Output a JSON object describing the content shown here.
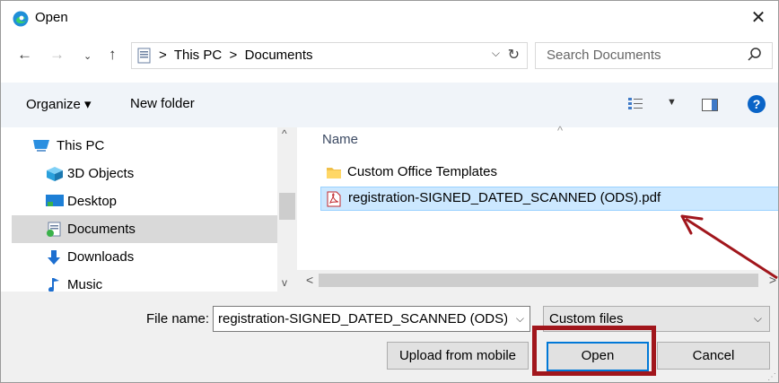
{
  "window": {
    "title": "Open",
    "app_icon": "edge-icon",
    "close_label": "✕"
  },
  "address": {
    "crumbs": [
      "This PC",
      "Documents"
    ],
    "separator": ">",
    "search_placeholder": "Search Documents"
  },
  "toolbar": {
    "organize_label": "Organize ▾",
    "new_folder_label": "New folder",
    "help_label": "?"
  },
  "nav": {
    "items": [
      {
        "label": "This PC",
        "icon": "computer-icon"
      },
      {
        "label": "3D Objects",
        "icon": "3d-objects-icon"
      },
      {
        "label": "Desktop",
        "icon": "desktop-icon"
      },
      {
        "label": "Documents",
        "icon": "documents-icon",
        "selected": true
      },
      {
        "label": "Downloads",
        "icon": "downloads-icon"
      },
      {
        "label": "Music",
        "icon": "music-icon"
      }
    ]
  },
  "files": {
    "column_name": "Name",
    "rows": [
      {
        "label": "Custom Office Templates",
        "icon": "folder-icon"
      },
      {
        "label": "registration-SIGNED_DATED_SCANNED (ODS).pdf",
        "icon": "pdf-icon",
        "selected": true
      }
    ]
  },
  "bottom": {
    "file_name_label": "File name:",
    "file_name_value": "registration-SIGNED_DATED_SCANNED (ODS).",
    "file_type_value": "Custom files",
    "upload_label": "Upload from mobile",
    "open_label": "Open",
    "cancel_label": "Cancel"
  },
  "colors": {
    "annotation": "#a1161c",
    "selection": "#cce8ff",
    "accent": "#0078d7"
  }
}
